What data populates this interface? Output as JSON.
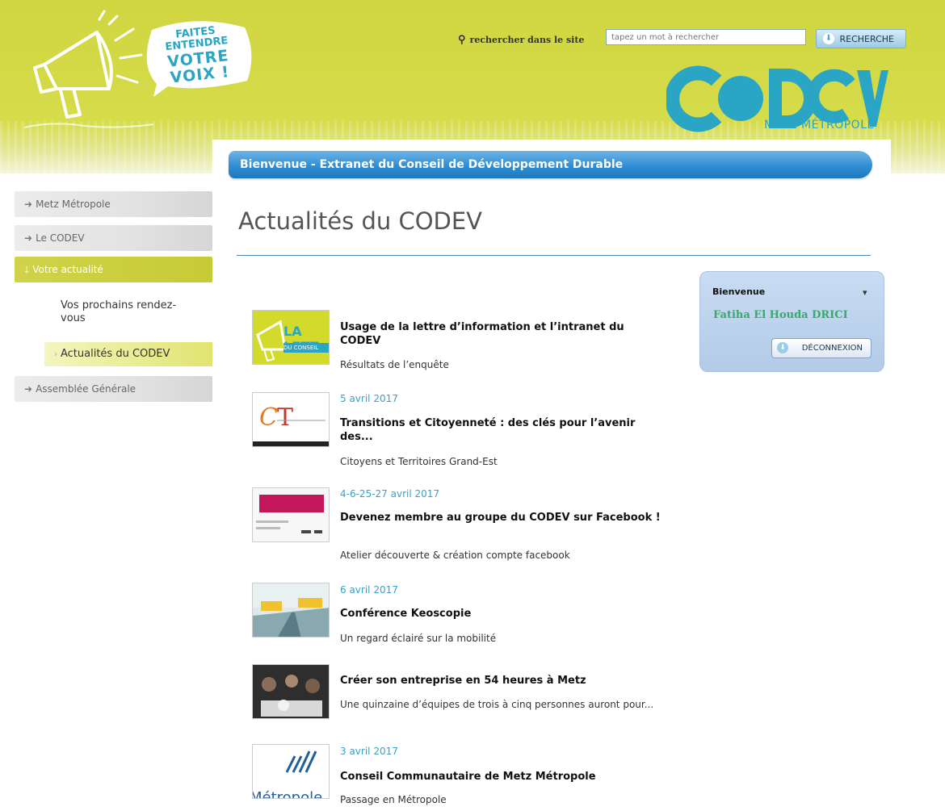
{
  "header": {
    "slogan_line1": "FAITES ENTENDRE",
    "slogan_line2": "VOTRE VOIX !",
    "search_label": "rechercher dans le site",
    "search_placeholder": "tapez un mot à rechercher",
    "search_button": "RECHERCHE",
    "logo_text": "CODEV",
    "logo_subtitle": "METZ MÉTROPOLE",
    "colors": {
      "lime": "#cfd640",
      "cyan": "#2aa5c4"
    }
  },
  "sidebar": {
    "items": [
      {
        "label": "Metz Métropole"
      },
      {
        "label": "Le CODEV"
      },
      {
        "label": "Votre actualité"
      },
      {
        "label": "Assemblée Générale"
      }
    ],
    "subitems": [
      {
        "label": "Vos prochains rendez-vous"
      },
      {
        "label": "Actualités du CODEV"
      }
    ]
  },
  "main": {
    "banner": "Bienvenue - Extranet du Conseil de Développement Durable",
    "title": "Actualités du CODEV",
    "news": [
      {
        "date": "",
        "title": "Usage de la lettre d’information et l’intranet du CODEV",
        "desc": "Résultats de l’enquête",
        "thumb_text": "LA LETT",
        "thumb_sub": "DU CONSEIL"
      },
      {
        "date": "5 avril 2017",
        "title": "Transitions et Citoyenneté : des clés pour l’avenir des...",
        "desc": "Citoyens et Territoires Grand-Est"
      },
      {
        "date": "4-6-25-27 avril 2017",
        "title": "Devenez membre au groupe du CODEV sur Facebook !",
        "desc": "Atelier découverte & création compte facebook"
      },
      {
        "date": "6 avril 2017",
        "title": "Conférence Keoscopie",
        "desc": "Un regard éclairé sur la mobilité"
      },
      {
        "date": "",
        "title": "Créer son entreprise en 54 heures à Metz",
        "desc": "Une quinzaine d’équipes de trois à cinq personnes auront pour..."
      },
      {
        "date": "3 avril 2017",
        "title": "Conseil Communautaire de Metz Métropole",
        "desc": "Passage en Métropole",
        "thumb_text": ": Métropole"
      }
    ]
  },
  "welcome": {
    "heading": "Bienvenue",
    "user": "Fatiha El Houda DRICI",
    "logout": "DÉCONNEXION"
  }
}
